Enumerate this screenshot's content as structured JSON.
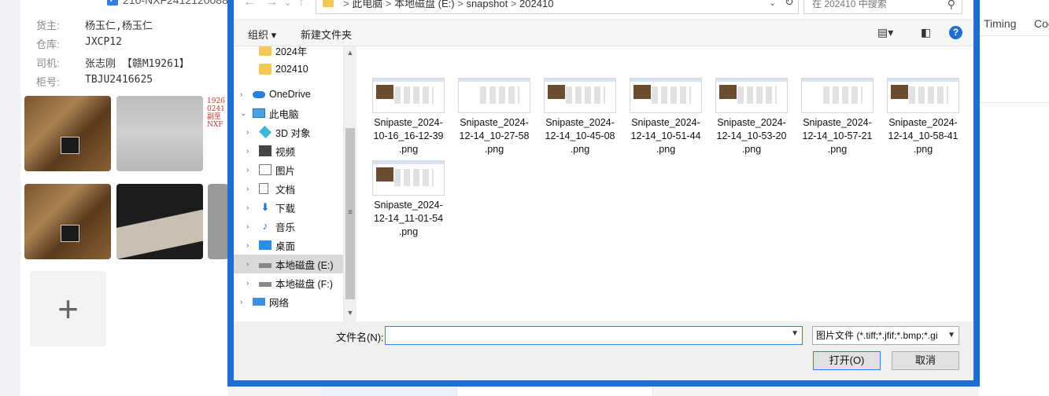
{
  "background": {
    "top_row_text": "210-NXF2412120088",
    "info": [
      {
        "label": "货主:",
        "value": "杨玉仁,杨玉仁"
      },
      {
        "label": "仓库:",
        "value": "JXCP12"
      },
      {
        "label": "司机:",
        "value": "张志刚 【赣M19261】"
      },
      {
        "label": "柜号:",
        "value": "TBJU2416625"
      }
    ],
    "scribble_text": "1926 0241 副至 NXF",
    "add_symbol": "+",
    "right_tabs": [
      "Timing",
      "Coo"
    ]
  },
  "dialog": {
    "address_path": [
      "此电脑",
      "本地磁盘 (E:)",
      "snapshot",
      "202410"
    ],
    "search_placeholder": "在 202410 中搜索",
    "toolbar": {
      "organize": "组织 ▾",
      "new_folder": "新建文件夹"
    },
    "nav_items": [
      {
        "label": "2024年",
        "icon": "folder-check-icon",
        "level": 2,
        "expand": false
      },
      {
        "label": "202410",
        "icon": "folder-icon",
        "level": 2,
        "expand": false
      },
      {
        "label": "OneDrive",
        "icon": "cloud-icon",
        "level": 1,
        "expand": true
      },
      {
        "label": "此电脑",
        "icon": "pc-icon",
        "level": 1,
        "expand": true,
        "expanded": true
      },
      {
        "label": "3D 对象",
        "icon": "cube-icon",
        "level": 2,
        "expand": true
      },
      {
        "label": "视频",
        "icon": "video-icon",
        "level": 2,
        "expand": true
      },
      {
        "label": "图片",
        "icon": "pictures-icon",
        "level": 2,
        "expand": true
      },
      {
        "label": "文档",
        "icon": "document-icon",
        "level": 2,
        "expand": true
      },
      {
        "label": "下载",
        "icon": "download-icon",
        "level": 2,
        "expand": true
      },
      {
        "label": "音乐",
        "icon": "music-icon",
        "level": 2,
        "expand": true
      },
      {
        "label": "桌面",
        "icon": "desktop-icon",
        "level": 2,
        "expand": true
      },
      {
        "label": "本地磁盘 (E:)",
        "icon": "drive-icon",
        "level": 2,
        "expand": true,
        "selected": true
      },
      {
        "label": "本地磁盘 (F:)",
        "icon": "drive-icon",
        "level": 2,
        "expand": true
      },
      {
        "label": "网络",
        "icon": "network-icon",
        "level": 1,
        "expand": true
      }
    ],
    "files": [
      {
        "name": "Snipaste_2024-10-16_16-12-39.png",
        "lines": [
          "Snipaste_2024-",
          "10-16_16-12-39",
          ".png"
        ]
      },
      {
        "name": "Snipaste_2024-12-14_10-27-58.png",
        "lines": [
          "Snipaste_2024-",
          "12-14_10-27-58",
          ".png"
        ]
      },
      {
        "name": "Snipaste_2024-12-14_10-45-08.png",
        "lines": [
          "Snipaste_2024-",
          "12-14_10-45-08",
          ".png"
        ]
      },
      {
        "name": "Snipaste_2024-12-14_10-51-44.png",
        "lines": [
          "Snipaste_2024-",
          "12-14_10-51-44",
          ".png"
        ]
      },
      {
        "name": "Snipaste_2024-12-14_10-53-20.png",
        "lines": [
          "Snipaste_2024-",
          "12-14_10-53-20",
          ".png"
        ]
      },
      {
        "name": "Snipaste_2024-12-14_10-57-21.png",
        "lines": [
          "Snipaste_2024-",
          "12-14_10-57-21",
          ".png"
        ]
      },
      {
        "name": "Snipaste_2024-12-14_10-58-41.png",
        "lines": [
          "Snipaste_2024-",
          "12-14_10-58-41",
          ".png"
        ]
      },
      {
        "name": "Snipaste_2024-12-14_11-01-54.png",
        "lines": [
          "Snipaste_2024-",
          "12-14_11-01-54",
          ".png"
        ]
      }
    ],
    "filename_label": "文件名(N):",
    "filename_value": "",
    "filetype_value": "图片文件 (*.tiff;*.jfif;*.bmp;*.gi",
    "open_button": "打开(O)",
    "cancel_button": "取消"
  },
  "colors": {
    "accent": "#1e6fd0",
    "selected_nav": "#d9d9d9"
  }
}
